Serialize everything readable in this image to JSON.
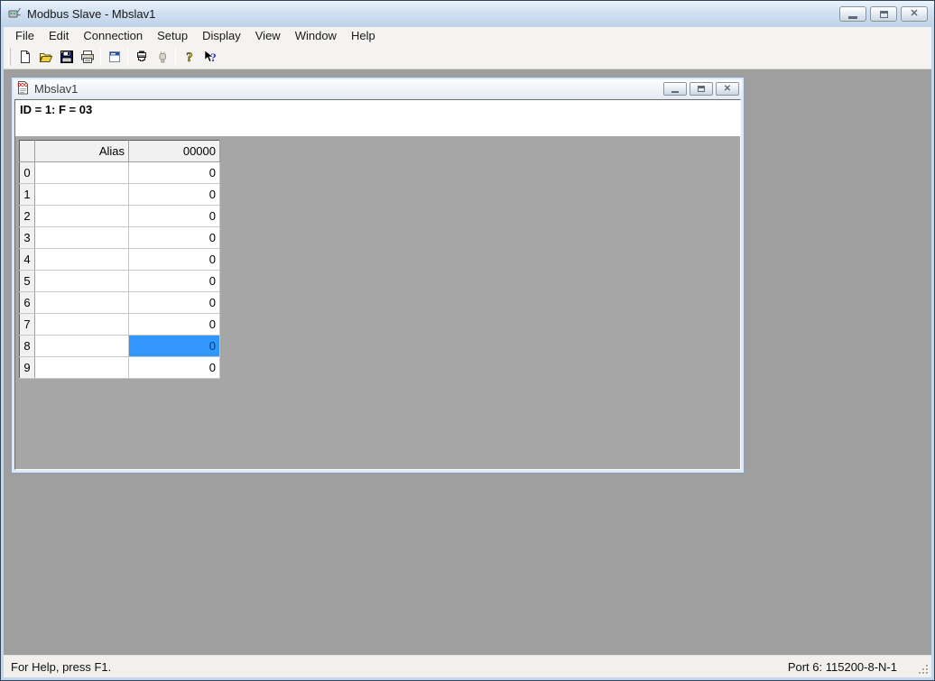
{
  "window": {
    "title": "Modbus Slave - Mbslav1",
    "controls": {
      "minimize": "minimize",
      "maximize": "maximize",
      "close": "close"
    }
  },
  "menu": {
    "items": [
      "File",
      "Edit",
      "Connection",
      "Setup",
      "Display",
      "View",
      "Window",
      "Help"
    ]
  },
  "toolbar": {
    "icons": [
      "new-document",
      "open-file",
      "save-file",
      "print",
      "display-settings",
      "connection-setup",
      "disconnect",
      "help-about",
      "context-help"
    ]
  },
  "child_window": {
    "title": "Mbslav1",
    "info_text": "ID = 1: F = 03",
    "controls": {
      "minimize": "minimize",
      "maximize": "maximize",
      "close": "close"
    }
  },
  "grid": {
    "columns": [
      "",
      "Alias",
      "00000"
    ],
    "rows": [
      {
        "index": "0",
        "alias": "",
        "value": "0"
      },
      {
        "index": "1",
        "alias": "",
        "value": "0"
      },
      {
        "index": "2",
        "alias": "",
        "value": "0"
      },
      {
        "index": "3",
        "alias": "",
        "value": "0"
      },
      {
        "index": "4",
        "alias": "",
        "value": "0"
      },
      {
        "index": "5",
        "alias": "",
        "value": "0"
      },
      {
        "index": "6",
        "alias": "",
        "value": "0"
      },
      {
        "index": "7",
        "alias": "",
        "value": "0"
      },
      {
        "index": "8",
        "alias": "",
        "value": "0"
      },
      {
        "index": "9",
        "alias": "",
        "value": "0"
      }
    ],
    "selected": {
      "row_index": 8,
      "column": "value"
    }
  },
  "status_bar": {
    "left": "For Help, press F1.",
    "right": "Port 6: 115200-8-N-1"
  },
  "colors": {
    "selection_bg": "#3297fd",
    "workspace_bg": "#9f9f9f",
    "titlebar_bg": "#c9daec",
    "frame_border": "#31465c",
    "header_bg": "#f1f1f1"
  }
}
